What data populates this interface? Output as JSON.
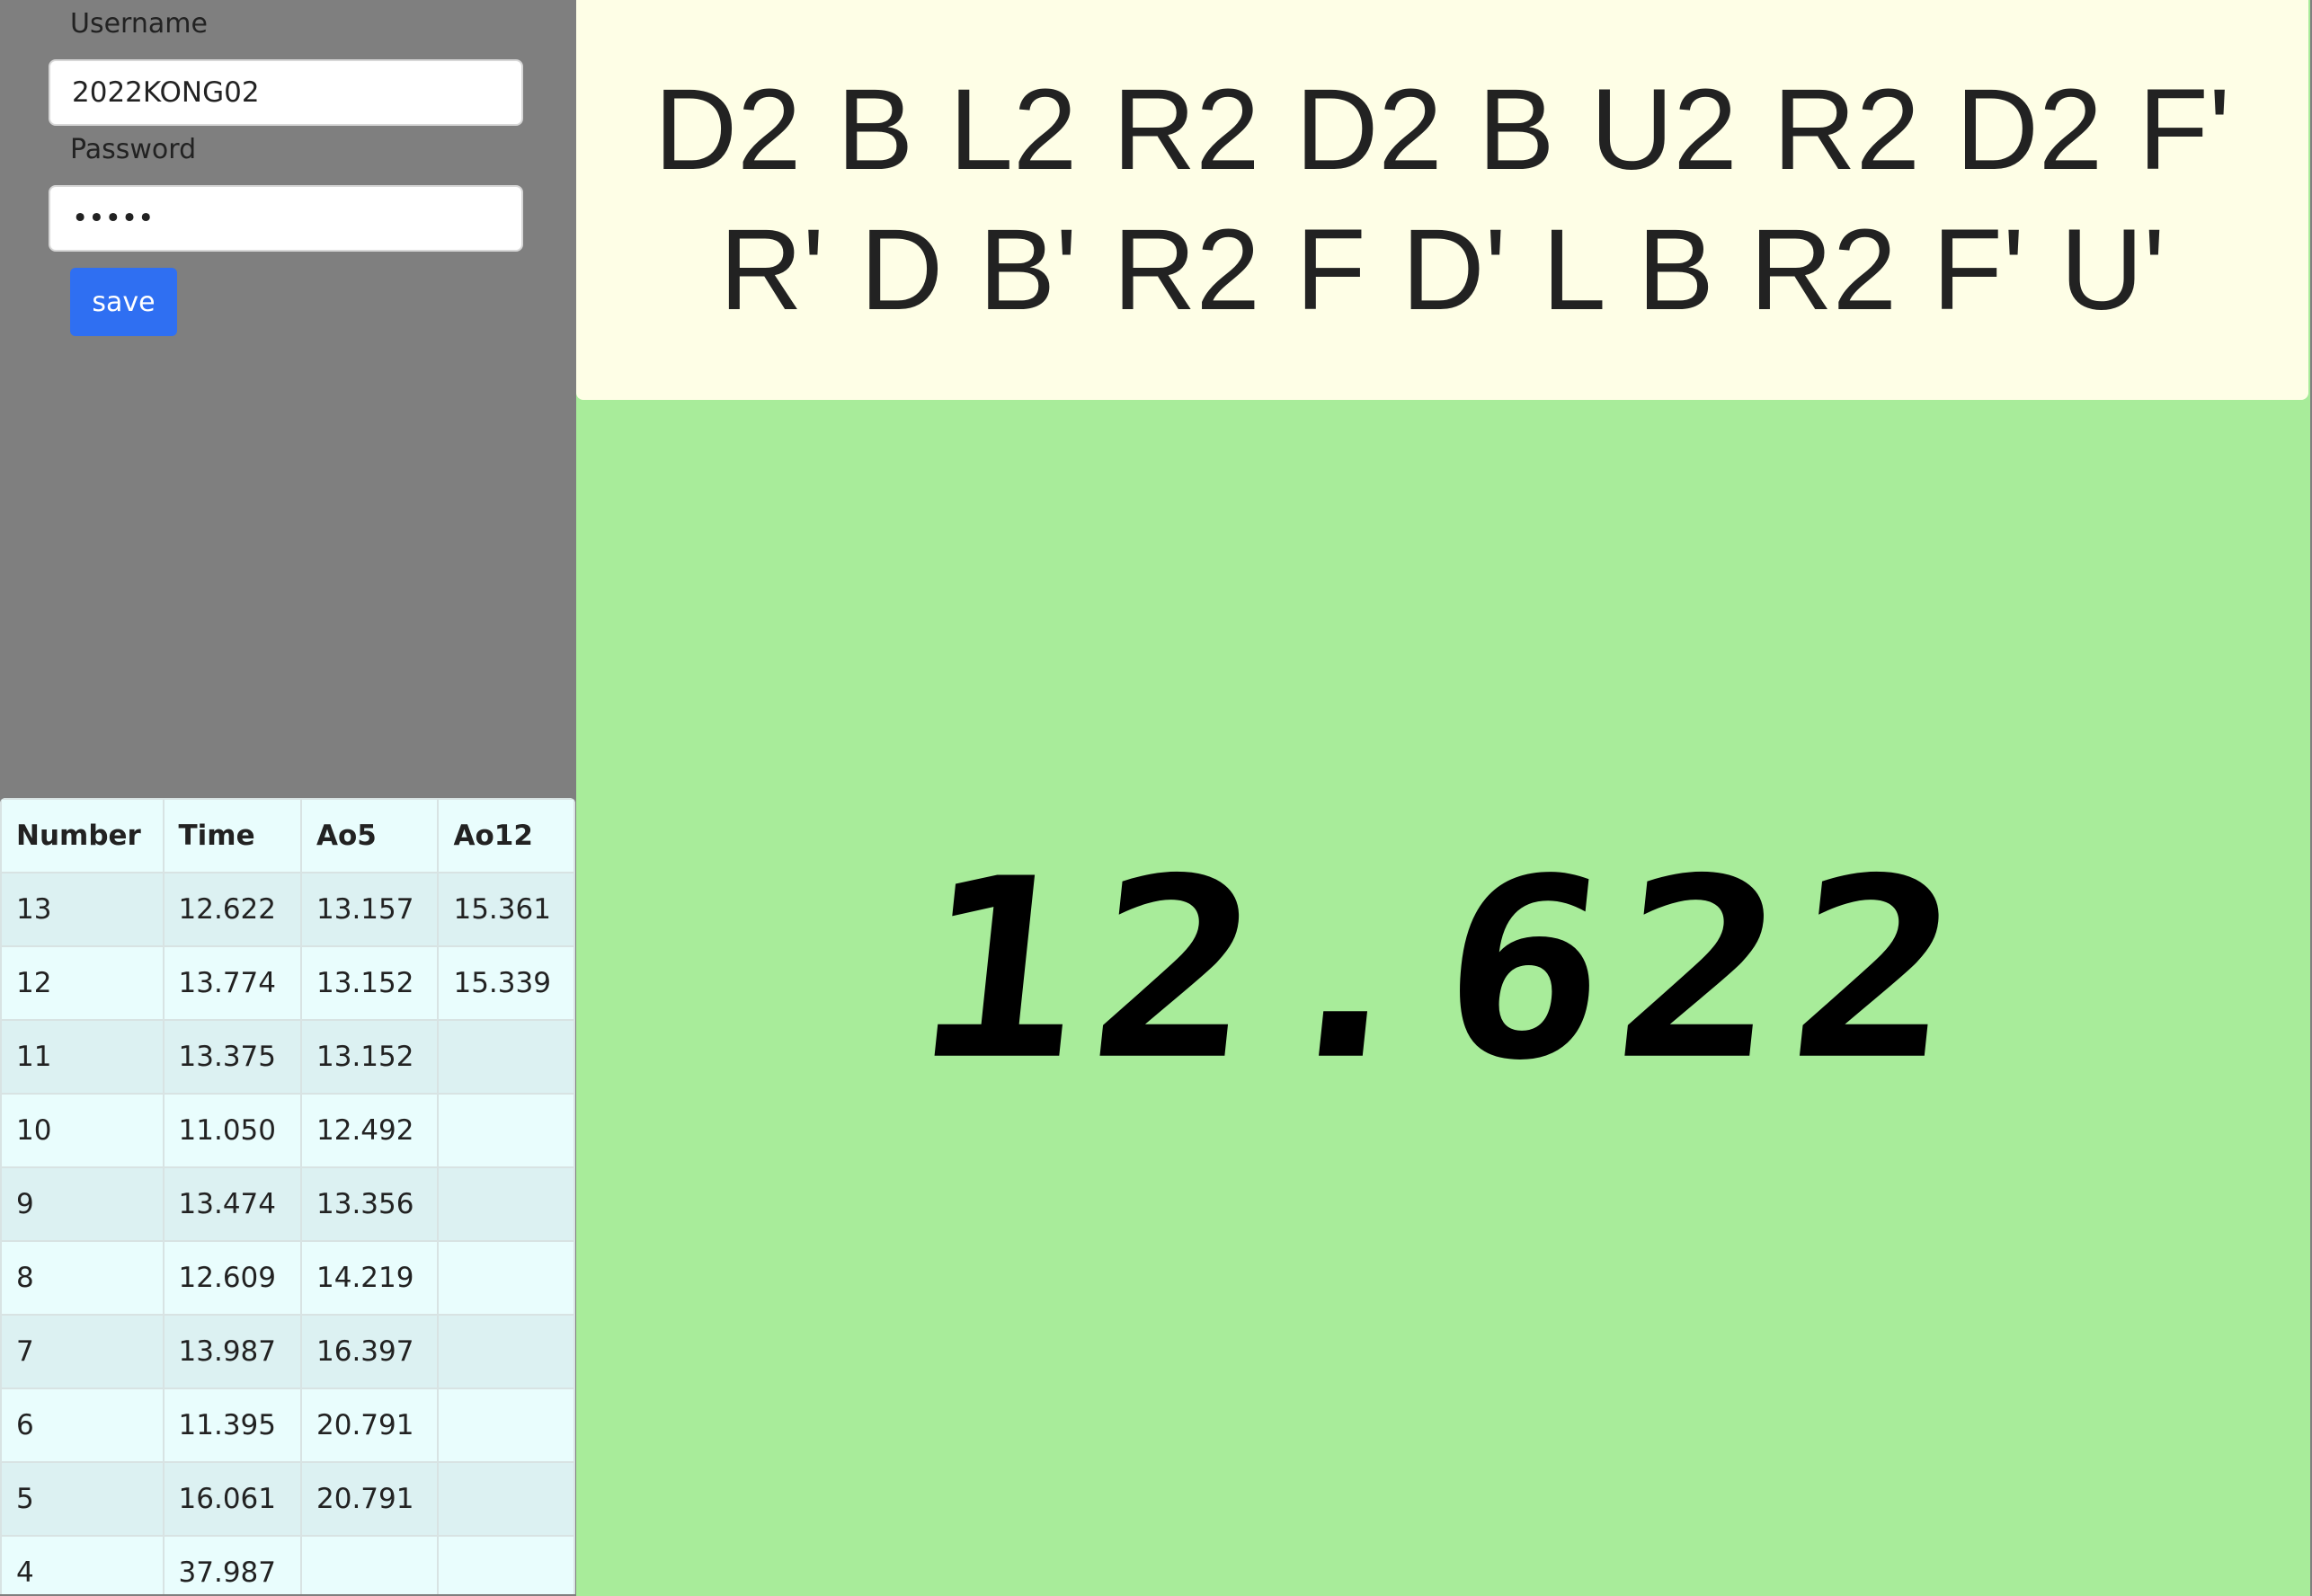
{
  "login": {
    "username_label": "Username",
    "username_value": "2022KONG02",
    "password_label": "Password",
    "password_value": "•••••",
    "save_label": "save"
  },
  "table": {
    "headers": [
      "Number",
      "Time",
      "Ao5",
      "Ao12"
    ],
    "rows": [
      [
        "13",
        "12.622",
        "13.157",
        "15.361"
      ],
      [
        "12",
        "13.774",
        "13.152",
        "15.339"
      ],
      [
        "11",
        "13.375",
        "13.152",
        ""
      ],
      [
        "10",
        "11.050",
        "12.492",
        ""
      ],
      [
        "9",
        "13.474",
        "13.356",
        ""
      ],
      [
        "8",
        "12.609",
        "14.219",
        ""
      ],
      [
        "7",
        "13.987",
        "16.397",
        ""
      ],
      [
        "6",
        "11.395",
        "20.791",
        ""
      ],
      [
        "5",
        "16.061",
        "20.791",
        ""
      ],
      [
        "4",
        "37.987",
        "",
        ""
      ]
    ]
  },
  "scramble": "D2 B L2 R2 D2 B U2 R2 D2 F' R' D B' R2 F D' L B R2 F' U'",
  "timer": "12.622",
  "colors": {
    "left_bg": "#7f7f7f",
    "scramble_bg": "#fefee6",
    "timer_bg": "#a8ec9a",
    "save_button": "#2f6ff2"
  }
}
